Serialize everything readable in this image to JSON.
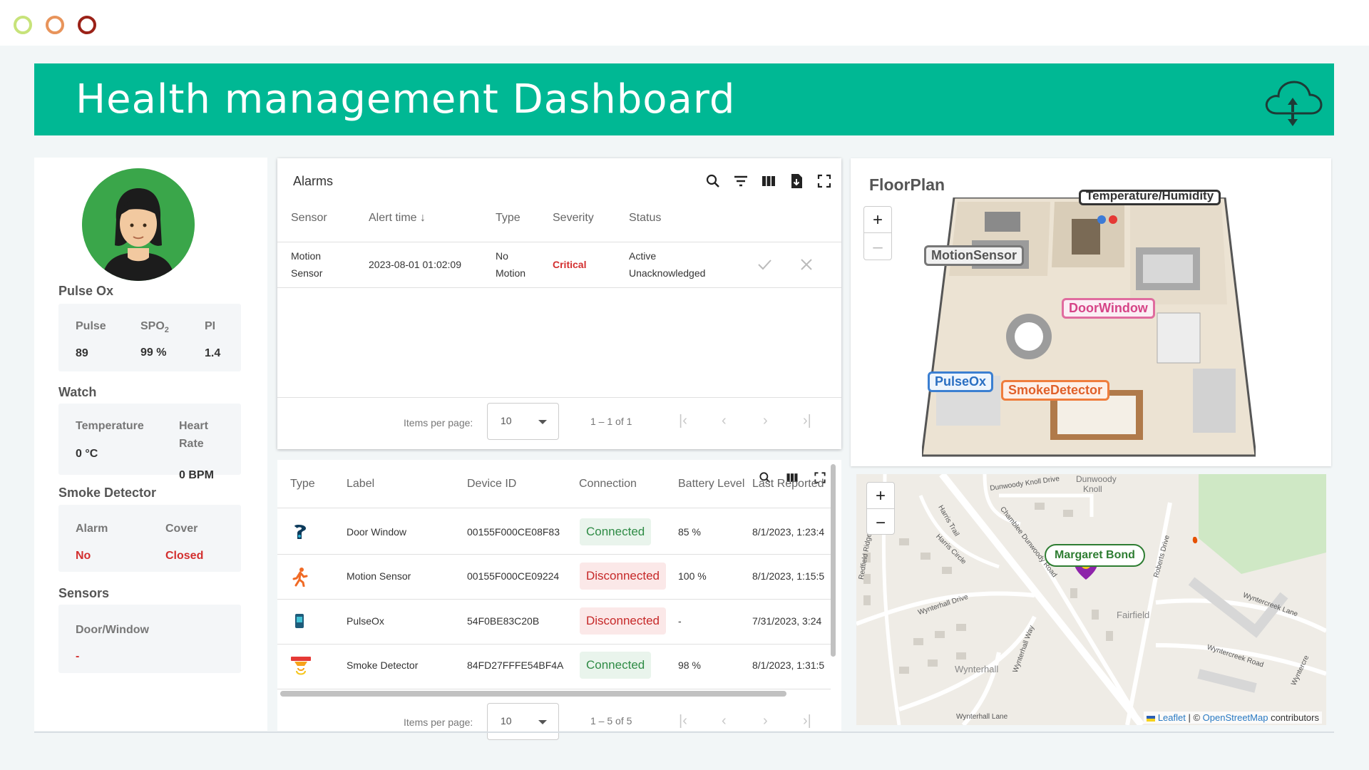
{
  "window": {
    "controls": [
      "minimize",
      "maximize",
      "close"
    ]
  },
  "header": {
    "title": "Health management Dashboard",
    "icon": "cloud-sync-icon"
  },
  "patient": {
    "pulse_ox": {
      "title": "Pulse Ox",
      "pulse_label": "Pulse",
      "pulse_value": "89",
      "spo2_label": "SPO",
      "spo2_sub": "2",
      "spo2_value": "99 %",
      "pi_label": "PI",
      "pi_value": "1.4"
    },
    "watch": {
      "title": "Watch",
      "temp_label": "Temperature",
      "temp_value": "0 °C",
      "hr_label_1": "Heart",
      "hr_label_2": "Rate",
      "hr_value": "0 BPM"
    },
    "smoke": {
      "title": "Smoke Detector",
      "alarm_label": "Alarm",
      "alarm_value": "No",
      "cover_label": "Cover",
      "cover_value": "Closed"
    },
    "sensors": {
      "title": "Sensors",
      "door_label": "Door/Window",
      "door_value": "-"
    }
  },
  "alarms": {
    "title": "Alarms",
    "columns": [
      "Sensor",
      "Alert time",
      "Type",
      "Severity",
      "Status"
    ],
    "rows": [
      {
        "sensor_1": "Motion",
        "sensor_2": "Sensor",
        "time": "2023-08-01 01:02:09",
        "type_1": "No",
        "type_2": "Motion",
        "severity": "Critical",
        "status_1": "Active",
        "status_2": "Unacknowledged"
      }
    ],
    "pager": {
      "label": "Items per page:",
      "size": "10",
      "range": "1 – 1 of 1"
    }
  },
  "devices": {
    "columns": [
      "Type",
      "Label",
      "Device ID",
      "Connection",
      "Battery Level",
      "Last Reported"
    ],
    "rows": [
      {
        "icon": "door-window-icon",
        "label": "Door Window",
        "id": "00155F000CE08F83",
        "connection": "Connected",
        "battery": "85 %",
        "last": "8/1/2023, 1:23:4"
      },
      {
        "icon": "motion-sensor-icon",
        "label": "Motion Sensor",
        "id": "00155F000CE09224",
        "connection": "Disconnected",
        "battery": "100 %",
        "last": "8/1/2023, 1:15:5"
      },
      {
        "icon": "pulse-ox-icon",
        "label": "PulseOx",
        "id": "54F0BE83C20B",
        "connection": "Disconnected",
        "battery": "-",
        "last": "7/31/2023, 3:24"
      },
      {
        "icon": "smoke-detector-icon",
        "label": "Smoke Detector",
        "id": "84FD27FFFE54BF4A",
        "connection": "Connected",
        "battery": "98 %",
        "last": "8/1/2023, 1:31:5"
      }
    ],
    "pager": {
      "label": "Items per page:",
      "size": "10",
      "range": "1 – 5 of 5"
    }
  },
  "floorplan": {
    "title": "FloorPlan",
    "zoom_in": "+",
    "zoom_out": "–",
    "labels": {
      "temp": "Temperature/Humidity",
      "motion": "MotionSensor",
      "door": "DoorWindow",
      "pulse": "PulseOx",
      "smoke": "SmokeDetector"
    }
  },
  "map": {
    "zoom_in": "+",
    "zoom_out": "−",
    "marker_label": "Margaret Bond",
    "streets": [
      "Dunwoody Knoll Drive",
      "Dunwoody",
      "Knoll",
      "Harris Trail",
      "Harris Circle",
      "Chamblee Dunwoody Road",
      "Redfield Ridge",
      "Wynterhall Drive",
      "Wynterhall Way",
      "Wynterhall",
      "Fairfield",
      "Roberts Drive",
      "Wyntercreek Lane",
      "Wyntercreek Road",
      "Wynterhall Lane",
      "Wyntercre"
    ],
    "attr_leaflet": "Leaflet",
    "attr_sep": " | © ",
    "attr_osm": "OpenStreetMap",
    "attr_tail": " contributors"
  }
}
